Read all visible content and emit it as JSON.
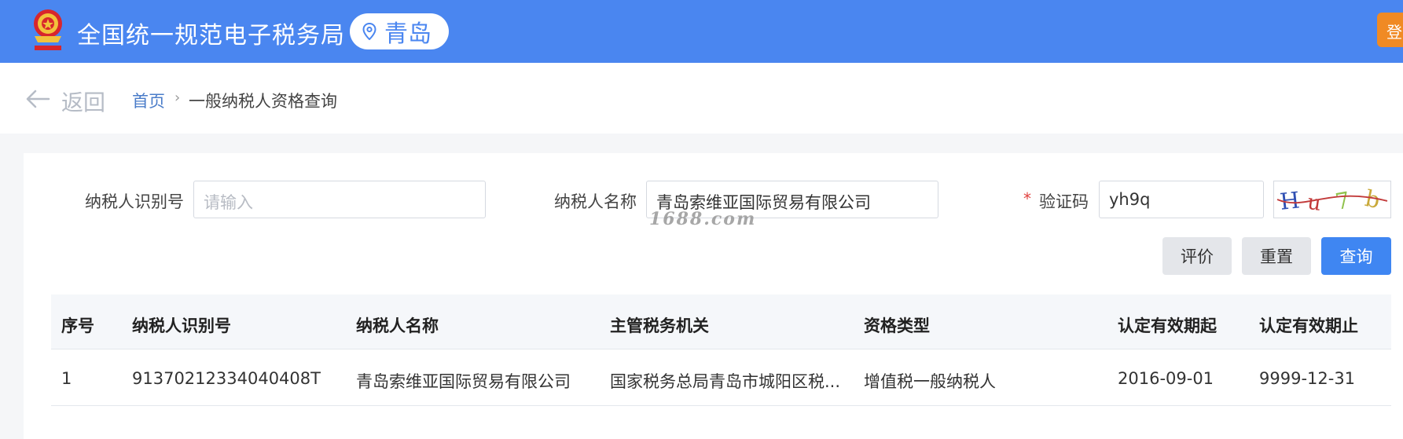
{
  "header": {
    "site_title": "全国统一规范电子税务局",
    "region": "青岛",
    "login_label": "登录",
    "bg_color": "#4a86f0"
  },
  "nav": {
    "back_label": "返回",
    "breadcrumb_home": "首页",
    "breadcrumb_separator": "›",
    "breadcrumb_current": "一般纳税人资格查询"
  },
  "form": {
    "taxpayer_id": {
      "label": "纳税人识别号",
      "placeholder": "请输入",
      "value": ""
    },
    "taxpayer_name": {
      "label": "纳税人名称",
      "value": "青岛索维亚国际贸易有限公司"
    },
    "captcha": {
      "label": "验证码",
      "required_mark": "*",
      "value": "yh9q",
      "image_text": "Hu7b"
    },
    "watermark": "1688.com"
  },
  "buttons": {
    "evaluate": "评价",
    "reset": "重置",
    "query": "查询"
  },
  "table": {
    "headers": [
      "序号",
      "纳税人识别号",
      "纳税人名称",
      "主管税务机关",
      "资格类型",
      "认定有效期起",
      "认定有效期止"
    ],
    "rows": [
      [
        "1",
        "91370212334040408T",
        "青岛索维亚国际贸易有限公司",
        "国家税务总局青岛市城阳区税...",
        "增值税一般纳税人",
        "2016-09-01",
        "9999-12-31"
      ]
    ]
  },
  "colors": {
    "accent": "#3f86f2",
    "required": "#e0413e",
    "login_button": "#f08a24"
  },
  "icons": [
    "tax-emblem-icon",
    "location-pin-icon",
    "back-arrow-icon"
  ]
}
